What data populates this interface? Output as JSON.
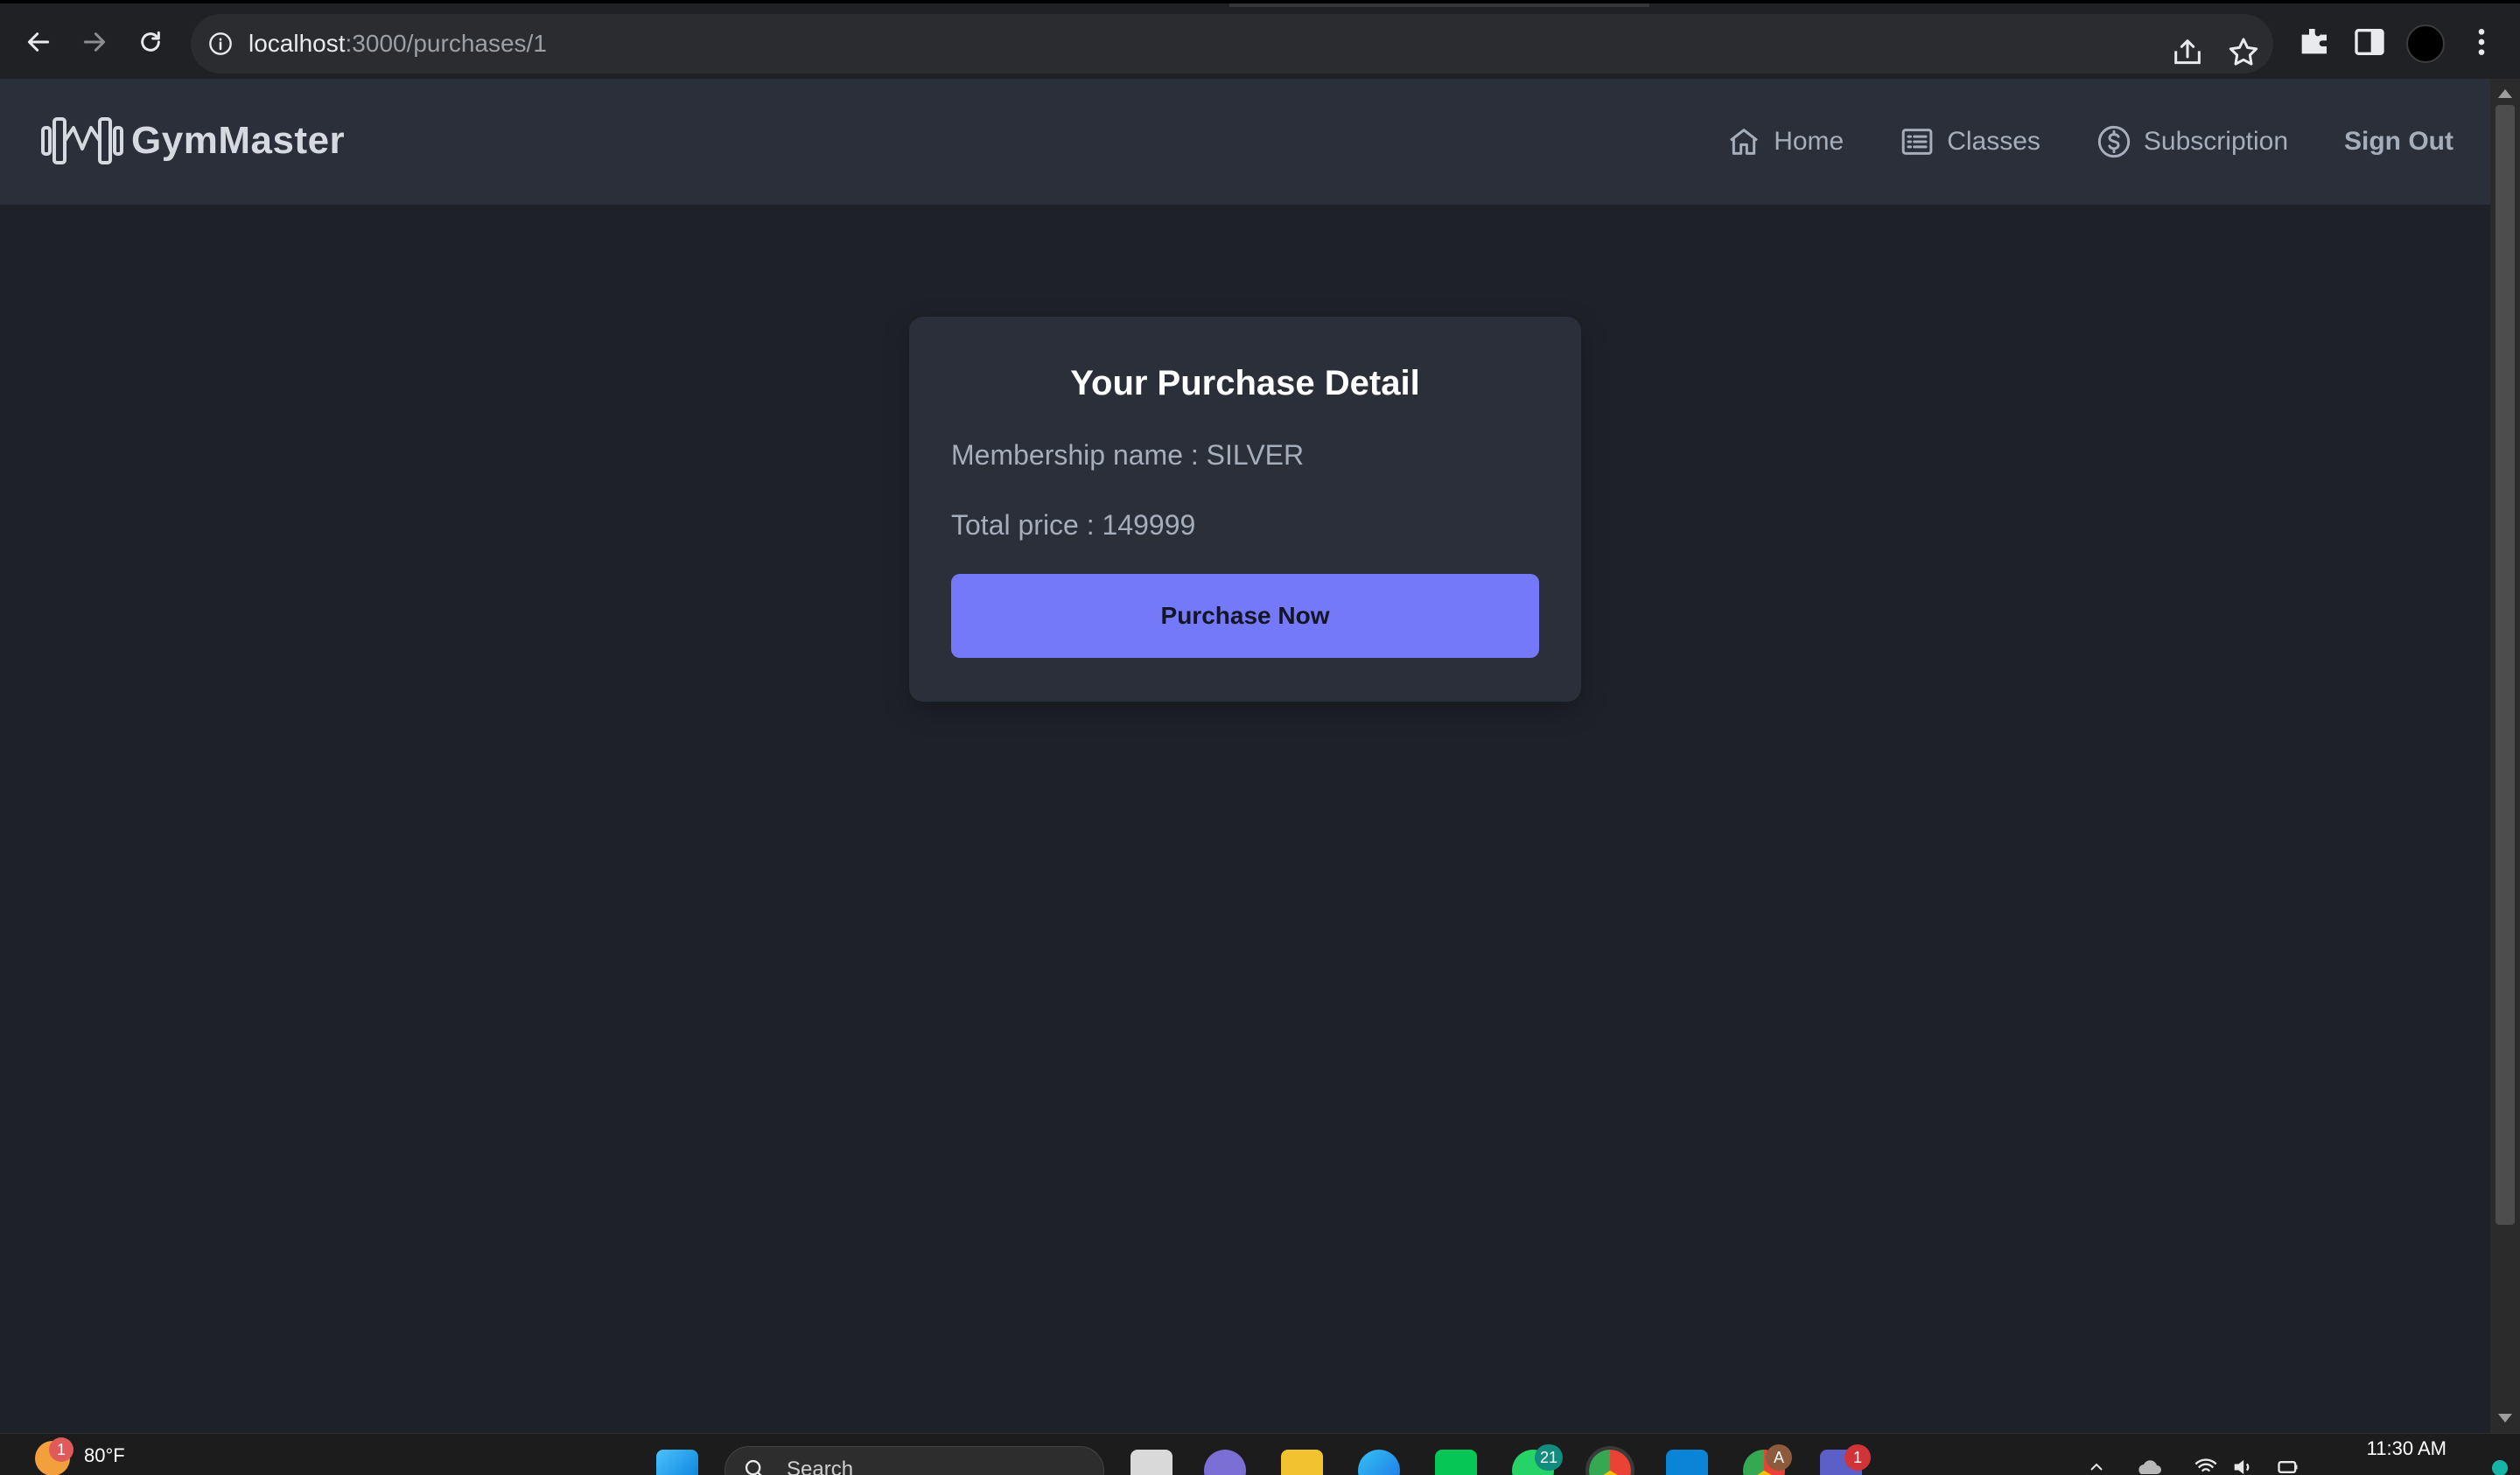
{
  "browser": {
    "url_host": "localhost",
    "url_path": ":3000/purchases/1"
  },
  "navbar": {
    "brand": "GymMaster",
    "links": [
      {
        "label": "Home",
        "icon": "home-icon"
      },
      {
        "label": "Classes",
        "icon": "list-icon"
      },
      {
        "label": "Subscription",
        "icon": "dollar-icon"
      }
    ],
    "signout_label": "Sign Out"
  },
  "purchase_card": {
    "title": "Your Purchase Detail",
    "membership_line": "Membership name : SILVER",
    "price_line": "Total price : 149999",
    "button_label": "Purchase Now"
  },
  "taskbar": {
    "weather_temp": "80°F",
    "weather_badge": "1",
    "search_placeholder": "Search",
    "whatsapp_badge": "21",
    "teams_badge": "1",
    "chrome_profile_badge": "A",
    "clock": "11:30 AM"
  },
  "colors": {
    "page_bg": "#1f2129",
    "navbar_bg": "#2a2f3a",
    "card_bg": "#2a2f3a",
    "accent": "#7479f9",
    "text_muted": "#a6adbb"
  }
}
